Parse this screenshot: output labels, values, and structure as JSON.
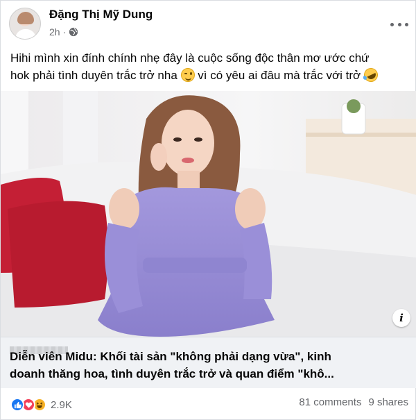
{
  "post": {
    "author": "Đặng Thị Mỹ Dung",
    "time": "2h",
    "privacy_icon": "globe-icon",
    "text_line1": "Hihi mình xin đính chính nhẹ đây là cuộc sống độc thân mơ ước chứ",
    "text_line2_a": "hok phải tình duyên trắc trở nha",
    "text_line2_b": "vì có yêu ai đâu mà trắc với trở",
    "emoji1": "winking-face",
    "emoji2": "rofl-face"
  },
  "link_preview": {
    "title_line1": "Diễn viên Midu: Khối tài sản \"không phải dạng vừa\", kinh",
    "title_line2": "doanh thăng hoa, tình duyên trắc trở và quan điểm \"khô..."
  },
  "footer": {
    "reaction_count": "2.9K",
    "reactions": [
      "like",
      "love",
      "haha"
    ],
    "comments": "81 comments",
    "shares": "9 shares"
  },
  "colors": {
    "dress": "#9b8fd6",
    "pillow": "#c41f35",
    "sofa": "#f4f4f4",
    "link_bg": "#f0f2f5",
    "like": "#1877f2",
    "love": "#f33e58",
    "haha": "#f7b125"
  }
}
